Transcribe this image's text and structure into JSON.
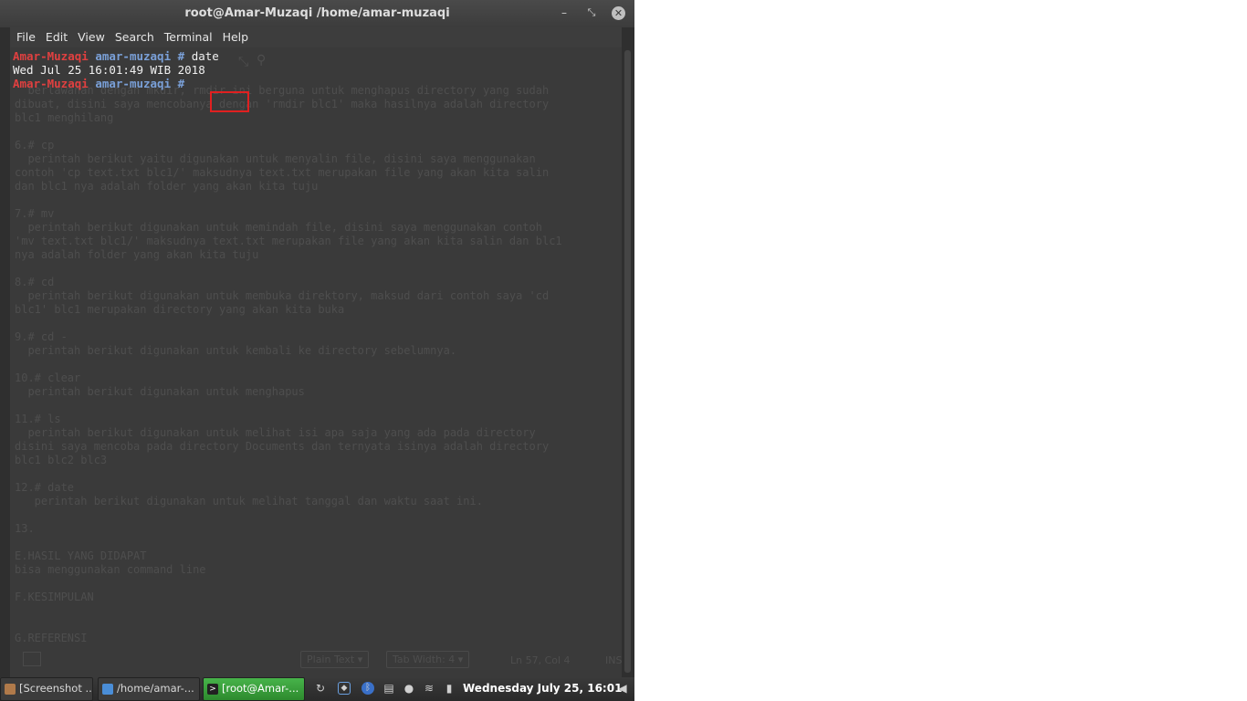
{
  "window": {
    "title": "root@Amar-Muzaqi /home/amar-muzaqi"
  },
  "menubar": {
    "items": [
      "File",
      "Edit",
      "View",
      "Search",
      "Terminal",
      "Help"
    ]
  },
  "terminal": {
    "host": "Amar-Muzaqi",
    "dir": "amar-muzaqi",
    "prompt_symbol": "#",
    "command": "date",
    "output": "Wed Jul 25 16:01:49 WIB 2018"
  },
  "background_text": "  berlawanan dengan mkdir, rmdir ini berguna untuk menghapus directory yang sudah\ndibuat, disini saya mencobanya dengan 'rmdir blc1' maka hasilnya adalah directory\nblc1 menghilang\n\n6.# cp\n  perintah berikut yaitu digunakan untuk menyalin file, disini saya menggunakan\ncontoh 'cp text.txt blc1/' maksudnya text.txt merupakan file yang akan kita salin\ndan blc1 nya adalah folder yang akan kita tuju\n\n7.# mv\n  perintah berikut digunakan untuk memindah file, disini saya menggunakan contoh\n'mv text.txt blc1/' maksudnya text.txt merupakan file yang akan kita salin dan blc1\nnya adalah folder yang akan kita tuju\n\n8.# cd\n  perintah berikut digunakan untuk membuka direktory, maksud dari contoh saya 'cd\nblc1' blc1 merupakan directory yang akan kita buka\n\n9.# cd -\n  perintah berikut digunakan untuk kembali ke directory sebelumnya.\n\n10.# clear\n  perintah berikut digunakan untuk menghapus\n\n11.# ls\n  perintah berikut digunakan untuk melihat isi apa saja yang ada pada directory\ndisini saya mencoba pada directory Documents dan ternyata isinya adalah directory\nblc1 blc2 blc3\n\n12.# date\n   perintah berikut digunakan untuk melihat tanggal dan waktu saat ini.\n\n13.\n\nE.HASIL YANG DIDAPAT\nbisa menggunakan command line\n\nF.KESIMPULAN\n\n\nG.REFERENSI",
  "editor_status": {
    "language": "Plain Text",
    "tab_width": "Tab Width: 4",
    "position": "Ln 57, Col 4",
    "mode": "INS"
  },
  "taskbar": {
    "tasks": [
      "[Screenshot ...",
      "/home/amar-...",
      "[root@Amar-..."
    ],
    "clock": "Wednesday July 25, 16:01"
  },
  "colors": {
    "prompt_host": "#e04040",
    "prompt_dir": "#7aa0d8",
    "active_task": "#3fa542",
    "highlight_box": "#e02020"
  }
}
